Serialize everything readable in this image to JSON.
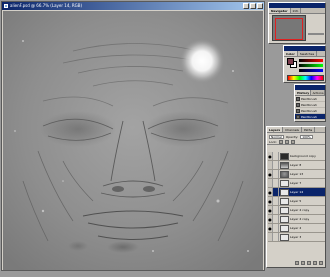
{
  "document": {
    "title": "alienF.psd @ 66.7% (Layer 14, RGB)"
  },
  "navigator": {
    "tabs": [
      "Navigator",
      "Info"
    ],
    "active_tab": "Navigator"
  },
  "color_panel": {
    "tabs": [
      "Color",
      "Swatches"
    ],
    "active_tab": "Color",
    "foreground": "#7a3a4a",
    "background": "#ffffff"
  },
  "history": {
    "tabs": [
      "History",
      "Actions"
    ],
    "items": [
      {
        "label": "Paintbrush",
        "selected": false
      },
      {
        "label": "Paintbrush",
        "selected": false
      },
      {
        "label": "Paintbrush",
        "selected": false
      },
      {
        "label": "Paintbrush",
        "selected": true
      }
    ]
  },
  "layers": {
    "tabs": [
      "Layers",
      "Channels",
      "Paths"
    ],
    "active_tab": "Layers",
    "blend_mode": "Normal",
    "opacity_label": "Opacity:",
    "opacity": "100%",
    "lock_label": "Lock:",
    "items": [
      {
        "name": "background copy",
        "thumb": "dark",
        "visible": true,
        "selected": false
      },
      {
        "name": "Layer 8",
        "thumb": "mid",
        "visible": false,
        "selected": false
      },
      {
        "name": "Layer 13",
        "thumb": "face",
        "visible": true,
        "selected": false
      },
      {
        "name": "Layer 7",
        "thumb": "light",
        "visible": false,
        "selected": false
      },
      {
        "name": "Layer 14",
        "thumb": "light",
        "visible": true,
        "selected": true
      },
      {
        "name": "Layer 5",
        "thumb": "light",
        "visible": true,
        "selected": false
      },
      {
        "name": "Layer 4 copy",
        "thumb": "light",
        "visible": true,
        "selected": false
      },
      {
        "name": "Layer 4 copy",
        "thumb": "light",
        "visible": true,
        "selected": false
      },
      {
        "name": "Layer 4",
        "thumb": "light",
        "visible": true,
        "selected": false
      },
      {
        "name": "Layer 3",
        "thumb": "light",
        "visible": false,
        "selected": false
      }
    ]
  }
}
